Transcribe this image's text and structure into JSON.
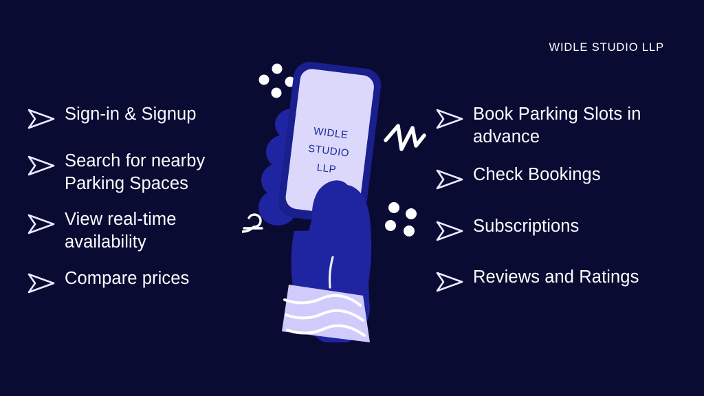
{
  "brand": {
    "name": "WIDLE STUDIO LLP"
  },
  "background_color": "#0a0b33",
  "colors": {
    "background": "#0a0b33",
    "text": "#fdfdff",
    "hand_blue": "#1f25a0",
    "hand_blue_dark": "#1a1f8e",
    "screen_lavender": "#dcd8fc",
    "cuff_lavender": "#cfcbfa",
    "accent_white": "#ffffff"
  },
  "columns": {
    "left": {
      "items": [
        {
          "label": "Sign-in & Signup",
          "bullet_icon": "arrow-right-outline-icon"
        },
        {
          "label": "Search for nearby\nParking Spaces",
          "bullet_icon": "arrow-right-outline-icon"
        },
        {
          "label": "View real-time\navailability",
          "bullet_icon": "arrow-right-outline-icon"
        },
        {
          "label": "Compare prices",
          "bullet_icon": "arrow-right-outline-icon"
        }
      ]
    },
    "right": {
      "items": [
        {
          "label": "Book Parking Slots in\nadvance",
          "bullet_icon": "arrow-right-outline-icon"
        },
        {
          "label": "Check Bookings",
          "bullet_icon": "arrow-right-outline-icon"
        },
        {
          "label": "Subscriptions",
          "bullet_icon": "arrow-right-outline-icon"
        },
        {
          "label": "Reviews and Ratings",
          "bullet_icon": "arrow-right-outline-icon"
        }
      ]
    }
  },
  "illustration": {
    "name": "hand-holding-phone-illustration",
    "phone_screen_lines": [
      "WIDLE",
      "STUDIO",
      "LLP"
    ],
    "decorations": [
      "dot-cluster-top-left",
      "dot-cluster-bottom-right",
      "zigzag-motion-line",
      "loop-squiggle-doodle",
      "sleeve-cuff-waves"
    ]
  }
}
